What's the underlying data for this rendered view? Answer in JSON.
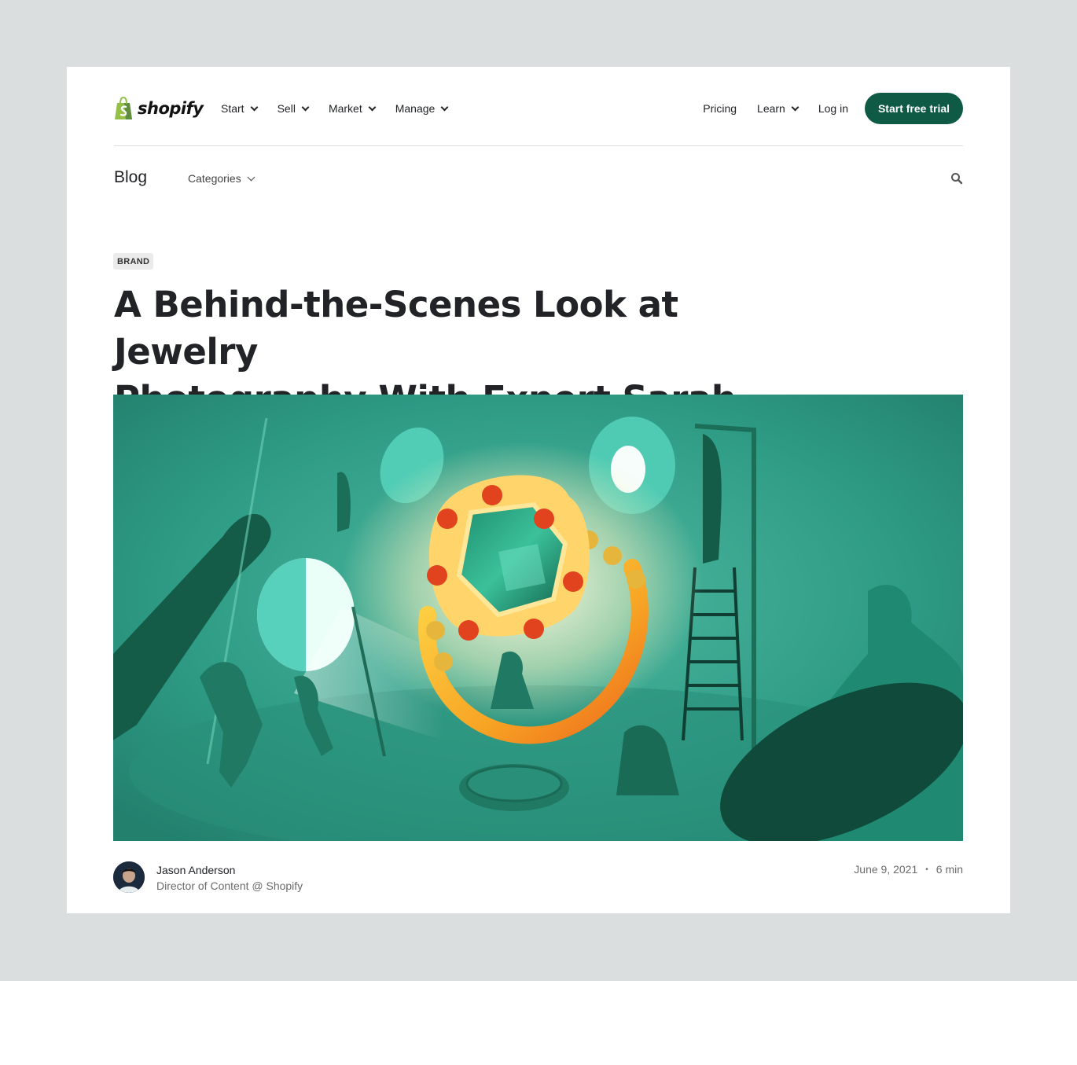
{
  "brand": {
    "name": "shopify",
    "accent": "#0e5a44",
    "logo_green": "#95bf47"
  },
  "nav": {
    "left": [
      {
        "label": "Start"
      },
      {
        "label": "Sell"
      },
      {
        "label": "Market"
      },
      {
        "label": "Manage"
      }
    ],
    "right": {
      "pricing": "Pricing",
      "learn": "Learn",
      "login": "Log in",
      "cta": "Start free trial"
    }
  },
  "blognav": {
    "title": "Blog",
    "categories": "Categories",
    "search_icon": "search-icon"
  },
  "article": {
    "category": "BRAND",
    "title_line1": "A Behind-the-Scenes Look at Jewelry",
    "title_line2": "Photography With Expert Sarah Pflug",
    "hero_icon": "jewelry-photography-illustration"
  },
  "author": {
    "name": "Jason Anderson",
    "role": "Director of Content @ Shopify"
  },
  "meta": {
    "date": "June 9, 2021",
    "separator": "•",
    "read_time": "6 min"
  }
}
